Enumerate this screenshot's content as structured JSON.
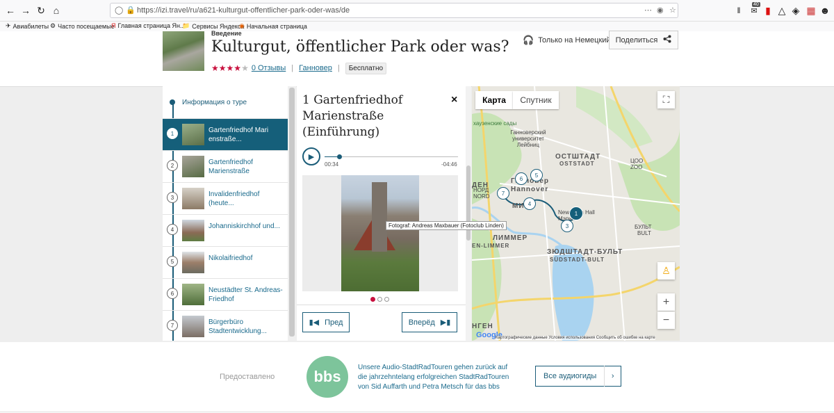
{
  "browser": {
    "url": "https://izi.travel/ru/a621-kulturgut-offentlicher-park-oder-was/de",
    "notification_count": "40",
    "bookmarks": [
      {
        "label": "Авиабилеты",
        "icon": "plane-icon"
      },
      {
        "label": "Часто посещаемые",
        "icon": "gear-icon"
      },
      {
        "label": "Главная страница Ян...",
        "icon": "yandex-icon"
      },
      {
        "label": "Сервисы Яндекса",
        "icon": "folder-icon"
      },
      {
        "label": "Начальная страница",
        "icon": "firefox-icon"
      }
    ]
  },
  "header": {
    "kicker": "Введение",
    "title": "Kulturgut, öffentlicher Park oder was?",
    "rating": 4,
    "rating_max": 5,
    "reviews_label": "0 Отзывы",
    "city": "Ганновер",
    "price": "Бесплатно",
    "language_label": "Только на Немецкий",
    "share_label": "Поделиться"
  },
  "sidebar": {
    "info_label": "Информация о туре",
    "items": [
      {
        "num": "1",
        "label": "Gartenfriedhof Mari enstraße...",
        "active": true
      },
      {
        "num": "2",
        "label": "Gartenfriedhof Marienstraße"
      },
      {
        "num": "3",
        "label": "Invalidenfriedhof (heute..."
      },
      {
        "num": "4",
        "label": "Johanniskirchhof und..."
      },
      {
        "num": "5",
        "label": "Nikolaifriedhof"
      },
      {
        "num": "6",
        "label": "Neustädter St. Andreas-Friedhof"
      },
      {
        "num": "7",
        "label": "Bürgerbüro Stadtentwicklung..."
      }
    ]
  },
  "detail": {
    "title": "1 Gartenfriedhof Marienstraße (Einführung)",
    "close": "×",
    "time_current": "00:34",
    "time_remaining": "-04:46",
    "progress": 0.11,
    "photo_caption": "Fotograf: Andreas Maxbauer (Fotoclub Linden)",
    "photo_index": 1,
    "photo_count": 3,
    "prev_label": "Пред",
    "next_label": "Вперёд"
  },
  "map": {
    "tab_map": "Карта",
    "tab_satellite": "Спутник",
    "labels": [
      {
        "text": "ОСТШТАДТ",
        "sub": "OSTSTADT"
      },
      {
        "text": "Ганноверский университет Лейбниц"
      },
      {
        "text": "хаузенские сады"
      },
      {
        "text": "Ганновер"
      },
      {
        "text": "Hannover"
      },
      {
        "text": "ЦОО"
      },
      {
        "text": "ZOO"
      },
      {
        "text": "БУЛЬТ"
      },
      {
        "text": "BULT"
      },
      {
        "text": "ЗЮДШТАДТ-БУЛЬТ"
      },
      {
        "text": "SÜDSTADT-BULT"
      },
      {
        "text": "ЛИММЕР"
      },
      {
        "text": "EN-LIMMER"
      },
      {
        "text": "New Town Hall"
      },
      {
        "text": "Мэрия"
      },
      {
        "text": "НОРД"
      },
      {
        "text": "NORD"
      },
      {
        "text": "МИ"
      },
      {
        "text": "ДЕН"
      },
      {
        "text": "НГЕН"
      }
    ],
    "markers": [
      "1",
      "3",
      "4",
      "5",
      "6",
      "7"
    ],
    "footer": "Картографические данные   Условия использования   Сообщить об ошибке на карте",
    "google": "Google"
  },
  "footer": {
    "provided_label": "Предоставлено",
    "logo_text": "bbs",
    "description": "Unsere Audio-StadtRadTouren gehen zurück auf die jahrzehntelang erfolgreichen StadtRadTouren von Sid Auffarth und Petra Metsch für das bbs",
    "all_guides_label": "Все аудиогиды"
  },
  "colors": {
    "accent": "#155f7a",
    "star": "#c8103e",
    "bbs": "#7dc49b"
  }
}
